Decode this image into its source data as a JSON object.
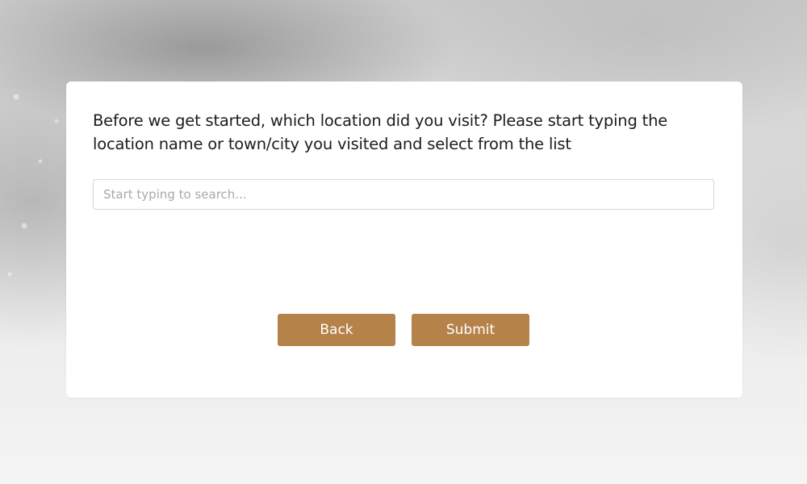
{
  "survey": {
    "question": "Before we get started, which location did you visit? Please start typing the location name or town/city you visited and select from the list",
    "search": {
      "value": "",
      "placeholder": "Start typing to search..."
    },
    "buttons": {
      "back_label": "Back",
      "submit_label": "Submit"
    }
  },
  "colors": {
    "accent": "#b5834a",
    "card_background": "#ffffff",
    "text": "#1c1c1c"
  }
}
